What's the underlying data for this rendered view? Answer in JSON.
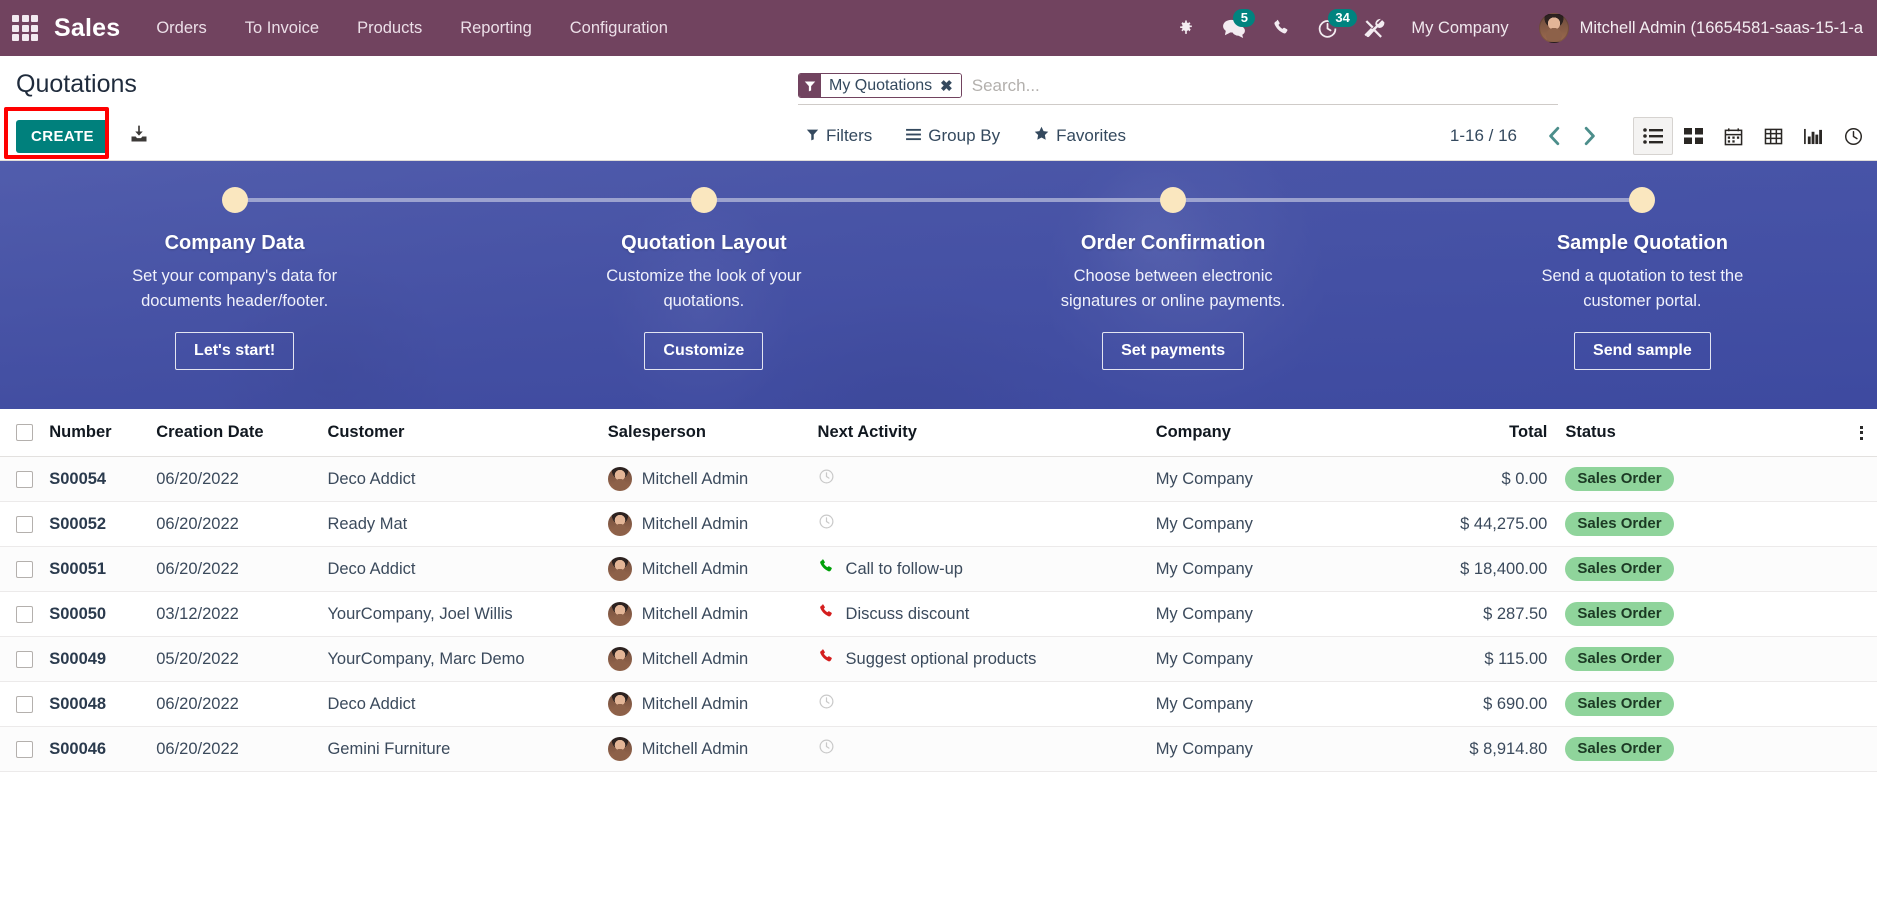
{
  "navbar": {
    "apps_icon": "apps-grid-icon",
    "brand": "Sales",
    "menu": [
      {
        "label": "Orders"
      },
      {
        "label": "To Invoice"
      },
      {
        "label": "Products"
      },
      {
        "label": "Reporting"
      },
      {
        "label": "Configuration"
      }
    ],
    "sysicons": [
      {
        "name": "bug-icon",
        "badge": null
      },
      {
        "name": "messages-icon",
        "badge": "5"
      },
      {
        "name": "phone-icon",
        "badge": null
      },
      {
        "name": "activities-clock-icon",
        "badge": "34"
      },
      {
        "name": "tools-icon",
        "badge": null
      }
    ],
    "company": "My Company",
    "user": "Mitchell Admin (16654581-saas-15-1-a",
    "bg_color": "#71435f"
  },
  "control_panel": {
    "page_title": "Quotations",
    "create_label": "CREATE",
    "create_color": "#00807c",
    "highlight_color": "#ff0000",
    "import_icon": "import-download-icon",
    "search": {
      "facet_icon": "filter-funnel-icon",
      "facet_label": "My Quotations",
      "facet_remove": "✖",
      "placeholder": "Search...",
      "value": ""
    },
    "dropdowns": [
      {
        "label": "Filters",
        "icon": "filter-funnel-icon"
      },
      {
        "label": "Group By",
        "icon": "group-lines-icon"
      },
      {
        "label": "Favorites",
        "icon": "star-icon"
      }
    ],
    "pager": "1-16 / 16",
    "prev_icon": "chevron-left-icon",
    "next_icon": "chevron-right-icon",
    "views": [
      {
        "name": "list-view-icon",
        "active": true
      },
      {
        "name": "kanban-view-icon",
        "active": false
      },
      {
        "name": "calendar-view-icon",
        "active": false
      },
      {
        "name": "pivot-view-icon",
        "active": false
      },
      {
        "name": "graph-view-icon",
        "active": false
      },
      {
        "name": "activity-view-icon",
        "active": false
      }
    ]
  },
  "banner": {
    "steps": [
      {
        "title": "Company Data",
        "desc": "Set your company's data for documents header/footer.",
        "button": "Let's start!"
      },
      {
        "title": "Quotation Layout",
        "desc": "Customize the look of your quotations.",
        "button": "Customize"
      },
      {
        "title": "Order Confirmation",
        "desc": "Choose between electronic signatures or online payments.",
        "button": "Set payments"
      },
      {
        "title": "Sample Quotation",
        "desc": "Send a quotation to test the customer portal.",
        "button": "Send sample"
      }
    ]
  },
  "table": {
    "columns": [
      "Number",
      "Creation Date",
      "Customer",
      "Salesperson",
      "Next Activity",
      "Company",
      "Total",
      "Status"
    ],
    "status_color": "#8fd49b",
    "rows": [
      {
        "number": "S00054",
        "date": "06/20/2022",
        "customer": "Deco Addict",
        "salesperson": "Mitchell Admin",
        "activity": "",
        "activity_icon": "clock-icon",
        "activity_color": "#c9c9c9",
        "company": "My Company",
        "total": "$ 0.00",
        "status": "Sales Order"
      },
      {
        "number": "S00052",
        "date": "06/20/2022",
        "customer": "Ready Mat",
        "salesperson": "Mitchell Admin",
        "activity": "",
        "activity_icon": "clock-icon",
        "activity_color": "#c9c9c9",
        "company": "My Company",
        "total": "$ 44,275.00",
        "status": "Sales Order"
      },
      {
        "number": "S00051",
        "date": "06/20/2022",
        "customer": "Deco Addict",
        "salesperson": "Mitchell Admin",
        "activity": "Call to follow-up",
        "activity_icon": "phone-icon",
        "activity_color": "#00a009",
        "company": "My Company",
        "total": "$ 18,400.00",
        "status": "Sales Order"
      },
      {
        "number": "S00050",
        "date": "03/12/2022",
        "customer": "YourCompany, Joel Willis",
        "salesperson": "Mitchell Admin",
        "activity": "Discuss discount",
        "activity_icon": "phone-icon",
        "activity_color": "#d41e1e",
        "company": "My Company",
        "total": "$ 287.50",
        "status": "Sales Order"
      },
      {
        "number": "S00049",
        "date": "05/20/2022",
        "customer": "YourCompany, Marc Demo",
        "salesperson": "Mitchell Admin",
        "activity": "Suggest optional products",
        "activity_icon": "phone-icon",
        "activity_color": "#d41e1e",
        "company": "My Company",
        "total": "$ 115.00",
        "status": "Sales Order"
      },
      {
        "number": "S00048",
        "date": "06/20/2022",
        "customer": "Deco Addict",
        "salesperson": "Mitchell Admin",
        "activity": "",
        "activity_icon": "clock-icon",
        "activity_color": "#c9c9c9",
        "company": "My Company",
        "total": "$ 690.00",
        "status": "Sales Order"
      },
      {
        "number": "S00046",
        "date": "06/20/2022",
        "customer": "Gemini Furniture",
        "salesperson": "Mitchell Admin",
        "activity": "",
        "activity_icon": "clock-icon",
        "activity_color": "#c9c9c9",
        "company": "My Company",
        "total": "$ 8,914.80",
        "status": "Sales Order"
      }
    ]
  }
}
